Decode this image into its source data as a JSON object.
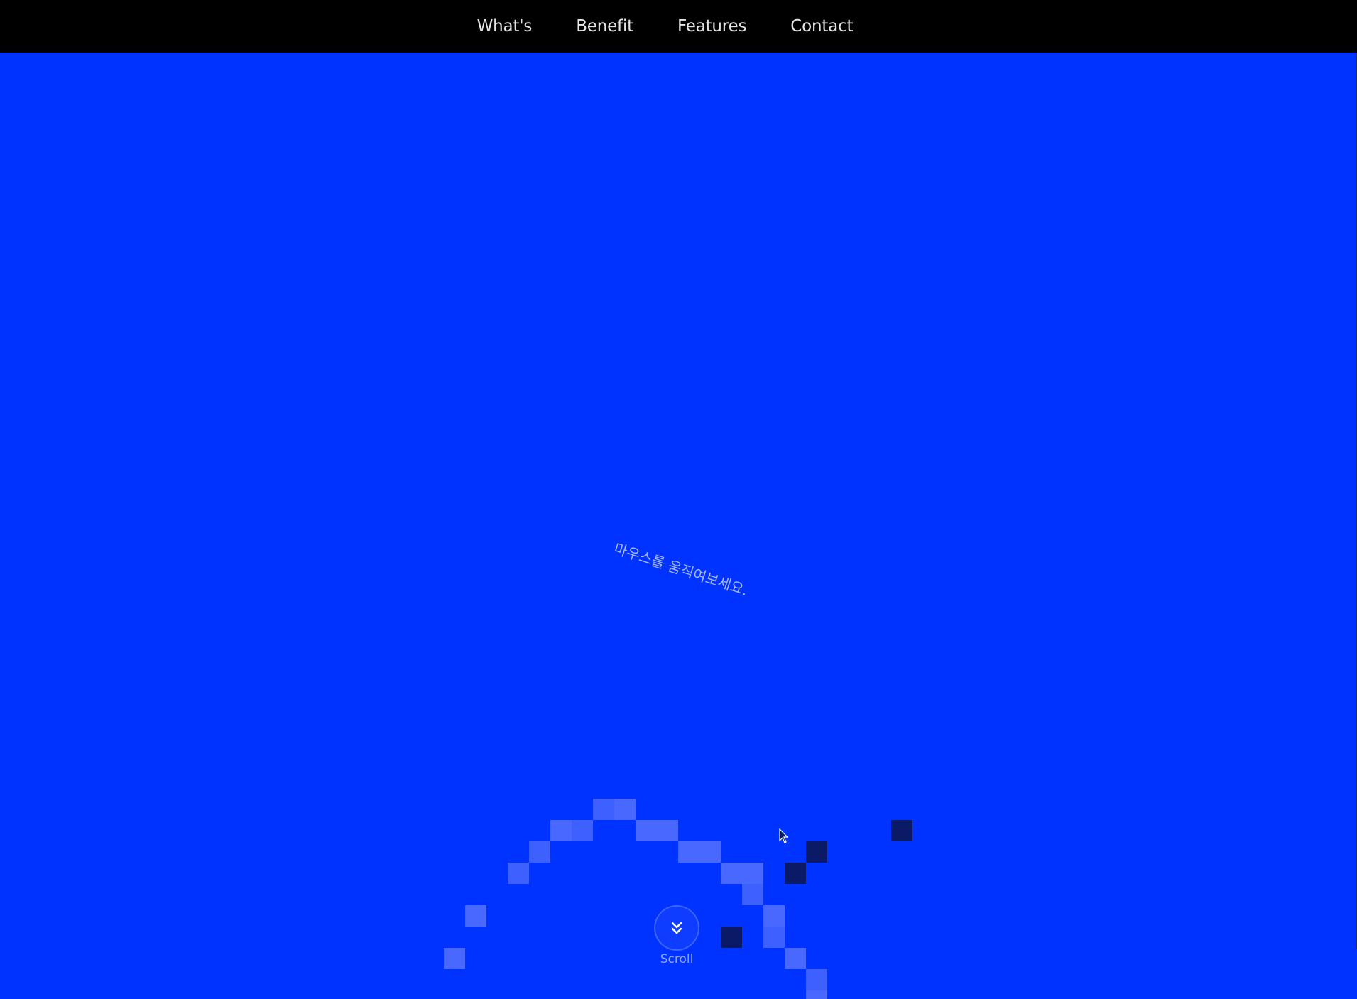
{
  "nav": {
    "items": [
      {
        "label": "What's"
      },
      {
        "label": "Benefit"
      },
      {
        "label": "Features"
      },
      {
        "label": "Contact"
      }
    ]
  },
  "hero": {
    "hint_text": "마우스를 움직여보세요."
  },
  "scroll": {
    "label": "Scroll",
    "icon": "double-chevron-down-icon"
  },
  "colors": {
    "background": "#0033ff",
    "nav_background": "#000000",
    "light_pixel": "#4d6bff",
    "dark_pixel": "#0a1a66"
  }
}
